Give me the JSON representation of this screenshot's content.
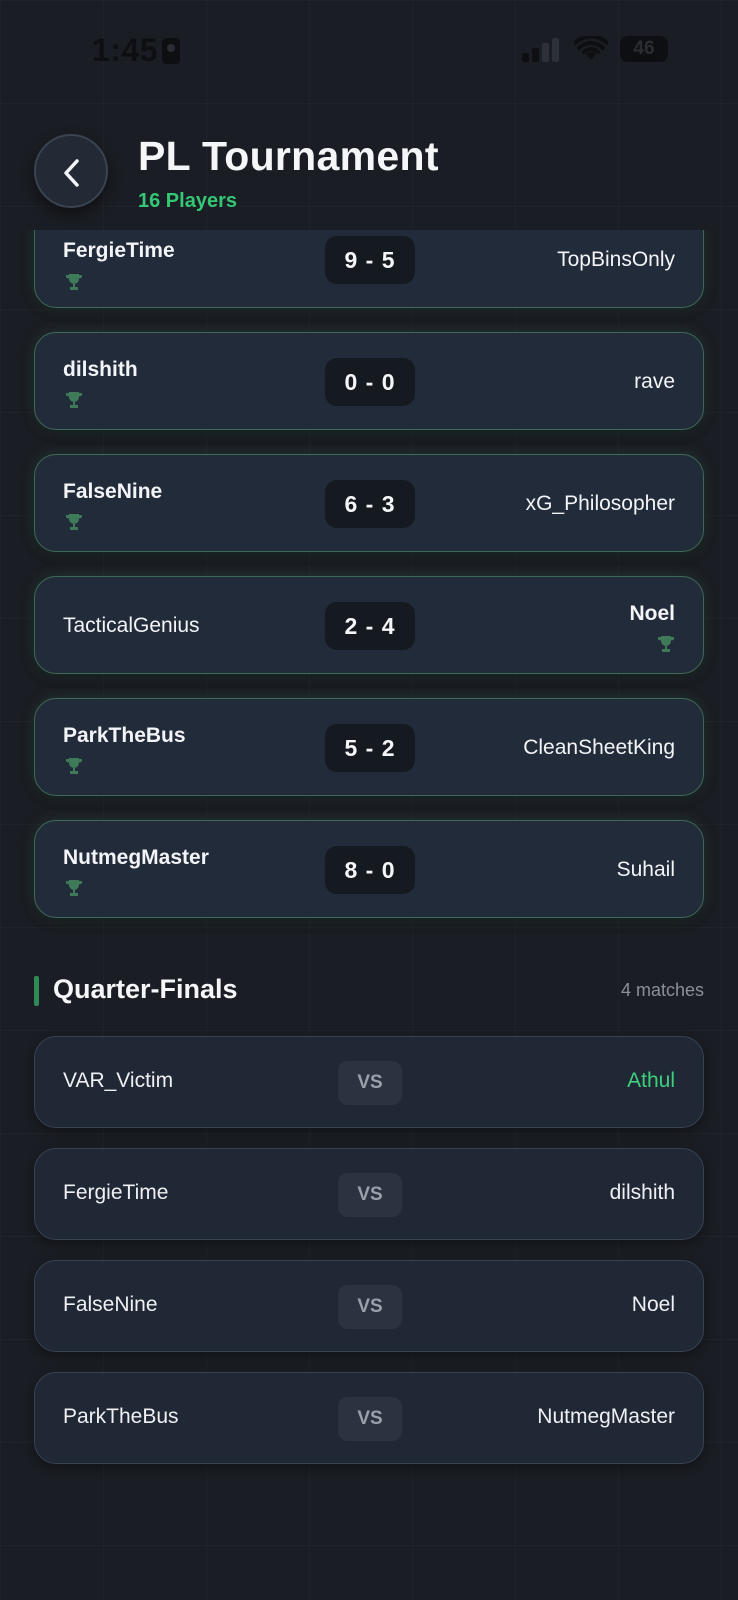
{
  "status_bar": {
    "time": "1:45",
    "battery": "46"
  },
  "header": {
    "title": "PL Tournament",
    "subtitle": "16 Players"
  },
  "matches": [
    {
      "home": "FergieTime",
      "score": "9 - 5",
      "away": "TopBinsOnly",
      "winner": "home"
    },
    {
      "home": "dilshith",
      "score": "0 - 0",
      "away": "rave",
      "winner": "home"
    },
    {
      "home": "FalseNine",
      "score": "6 - 3",
      "away": "xG_Philosopher",
      "winner": "home"
    },
    {
      "home": "TacticalGenius",
      "score": "2 - 4",
      "away": "Noel",
      "winner": "away"
    },
    {
      "home": "ParkTheBus",
      "score": "5 - 2",
      "away": "CleanSheetKing",
      "winner": "home"
    },
    {
      "home": "NutmegMaster",
      "score": "8 - 0",
      "away": "Suhail",
      "winner": "home"
    }
  ],
  "quarter_finals": {
    "title": "Quarter-Finals",
    "count": "4 matches",
    "vs_label": "VS",
    "matches": [
      {
        "home": "VAR_Victim",
        "away": "Athul",
        "away_highlight": true
      },
      {
        "home": "FergieTime",
        "away": "dilshith",
        "away_highlight": false
      },
      {
        "home": "FalseNine",
        "away": "Noel",
        "away_highlight": false
      },
      {
        "home": "ParkTheBus",
        "away": "NutmegMaster",
        "away_highlight": false
      }
    ]
  },
  "colors": {
    "accent_green": "#34c774",
    "background": "#1a1d23",
    "card": "#222b39"
  }
}
